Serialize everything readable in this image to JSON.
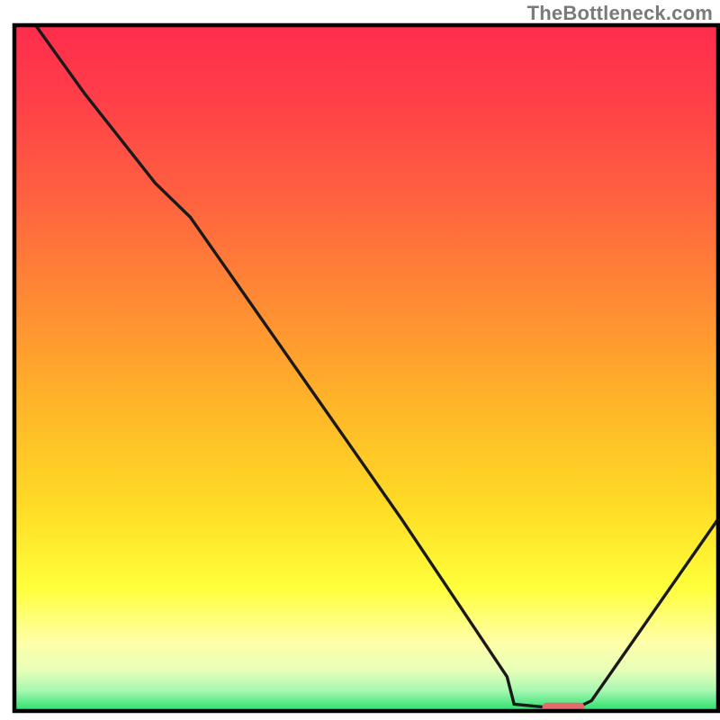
{
  "watermark": "TheBottleneck.com",
  "chart_data": {
    "type": "line",
    "title": "",
    "xlabel": "",
    "ylabel": "",
    "xlim": [
      0,
      100
    ],
    "ylim": [
      0,
      100
    ],
    "series": [
      {
        "name": "bottleneck-curve",
        "x": [
          3,
          10,
          20,
          25,
          40,
          55,
          70,
          71,
          76,
          80,
          82,
          100
        ],
        "y": [
          100,
          90,
          77,
          72,
          50,
          28,
          5,
          1,
          0.5,
          0.5,
          1.5,
          28
        ]
      }
    ],
    "marker": {
      "name": "optimal-marker",
      "x_center": 78,
      "y": 0.5,
      "width": 6,
      "color": "#e46a6f"
    },
    "gradient_stops": [
      {
        "offset": 0.0,
        "color": "#ff2c4c"
      },
      {
        "offset": 0.1,
        "color": "#ff3d49"
      },
      {
        "offset": 0.25,
        "color": "#ff6140"
      },
      {
        "offset": 0.4,
        "color": "#ff8a34"
      },
      {
        "offset": 0.55,
        "color": "#ffb429"
      },
      {
        "offset": 0.7,
        "color": "#ffdb25"
      },
      {
        "offset": 0.82,
        "color": "#ffff3a"
      },
      {
        "offset": 0.9,
        "color": "#ffffa8"
      },
      {
        "offset": 0.94,
        "color": "#e8ffb8"
      },
      {
        "offset": 0.97,
        "color": "#a8f7b2"
      },
      {
        "offset": 1.0,
        "color": "#26e06a"
      }
    ],
    "curve_stroke": "#1a1a1a",
    "frame_stroke": "#000000"
  }
}
